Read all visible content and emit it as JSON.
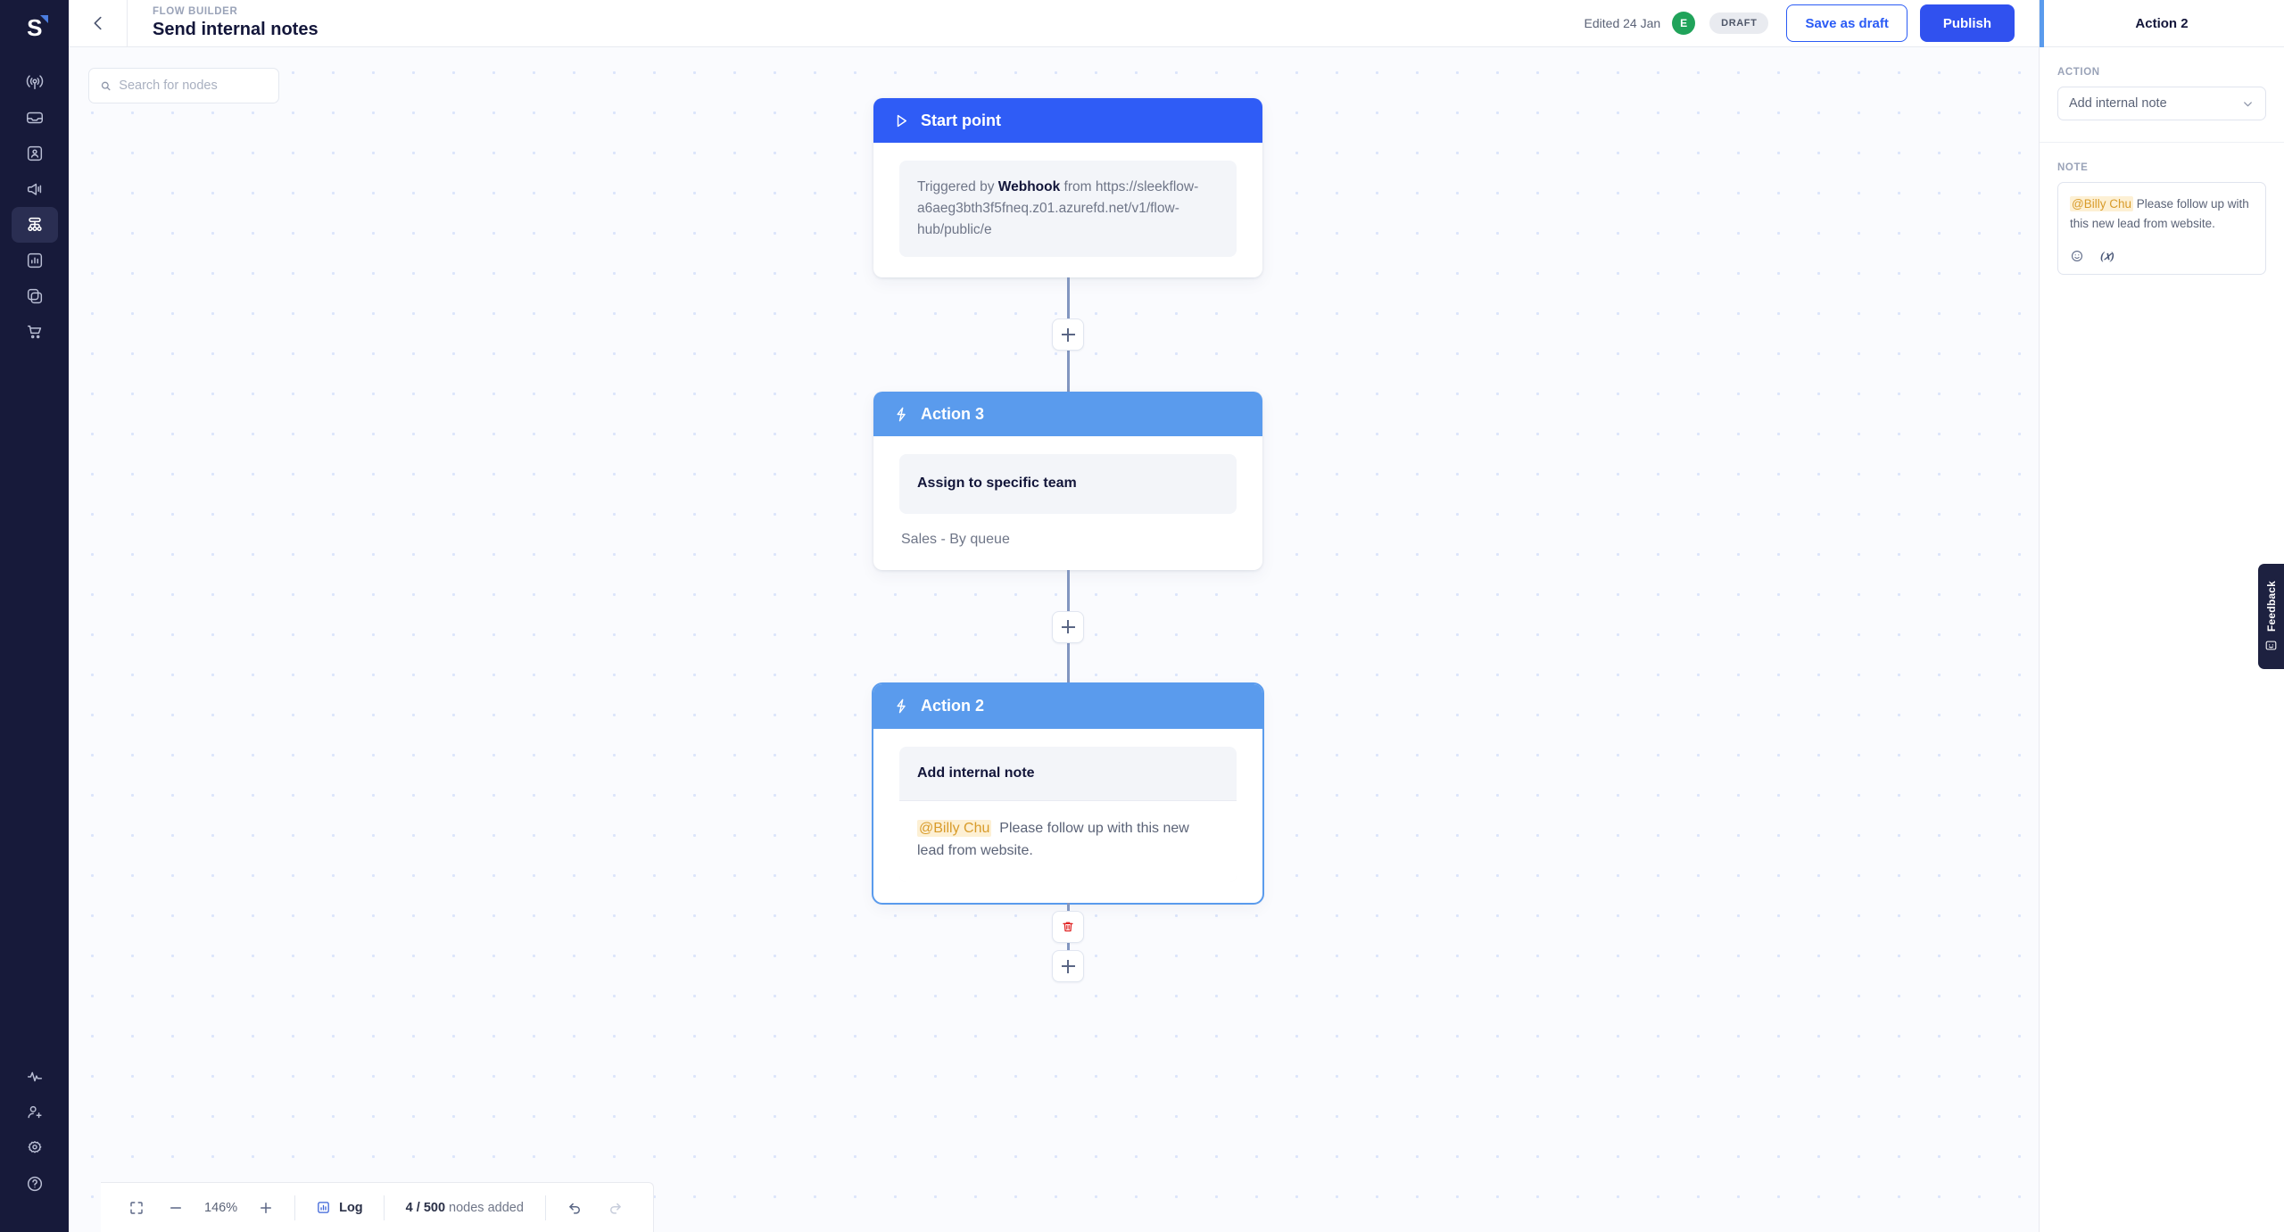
{
  "app": {
    "logo_letter": "S"
  },
  "sidebar": {
    "items": [
      {
        "name": "broadcast",
        "label": "Broadcast"
      },
      {
        "name": "inbox",
        "label": "Inbox"
      },
      {
        "name": "contacts",
        "label": "Contacts"
      },
      {
        "name": "campaigns",
        "label": "Campaigns"
      },
      {
        "name": "flow-builder",
        "label": "Flow Builder",
        "active": true
      },
      {
        "name": "analytics",
        "label": "Analytics"
      },
      {
        "name": "integrations",
        "label": "Integrations"
      },
      {
        "name": "commerce",
        "label": "Commerce"
      }
    ],
    "bottom_items": [
      {
        "name": "activity",
        "label": "Activity"
      },
      {
        "name": "invite-user",
        "label": "Invite user"
      },
      {
        "name": "settings",
        "label": "Settings"
      },
      {
        "name": "help",
        "label": "Help"
      }
    ]
  },
  "header": {
    "eyebrow": "FLOW BUILDER",
    "title": "Send internal notes",
    "edited": "Edited 24 Jan",
    "avatar_initial": "E",
    "status_badge": "DRAFT",
    "save_draft_label": "Save as draft",
    "publish_label": "Publish"
  },
  "canvas": {
    "search_placeholder": "Search for nodes",
    "search_value": ""
  },
  "flow": {
    "nodes": [
      {
        "id": "start-point",
        "header": "Start point",
        "icon": "play-icon",
        "body_prefix": "Triggered by ",
        "body_bold": "Webhook",
        "body_suffix": " from https://sleekflow-a6aeg3bth3f5fneq.z01.azurefd.net/v1/flow-hub/public/e"
      },
      {
        "id": "action-3",
        "header": "Action 3",
        "icon": "lightning-icon",
        "title": "Assign to specific team",
        "subtext": "Sales - By queue"
      },
      {
        "id": "action-2",
        "header": "Action 2",
        "icon": "lightning-icon",
        "title": "Add internal note",
        "note_mention": "@Billy Chu",
        "note_text": "Please follow up with this new lead from website.",
        "selected": true
      }
    ]
  },
  "toolbar": {
    "zoom_level": "146%",
    "log_label": "Log",
    "nodes_count": "4 / 500",
    "nodes_suffix": " nodes added"
  },
  "panel": {
    "title": "Action 2",
    "action_label": "ACTION",
    "action_value": "Add internal note",
    "note_label": "NOTE",
    "note_mention": "@Billy Chu",
    "note_text": " Please follow up with this new lead from website."
  },
  "feedback": {
    "label": "Feedback"
  },
  "colors": {
    "brand_blue": "#3051ef",
    "start_node_header": "#2f5cf6",
    "action_node_header": "#5a9bed",
    "rail_bg": "#171a3a",
    "canvas_bg": "#fafbfe",
    "mention": "#d89b2a",
    "mention_bg": "#fdf0d4",
    "avatar_green": "#20a35a",
    "delete_red": "#e02020"
  }
}
